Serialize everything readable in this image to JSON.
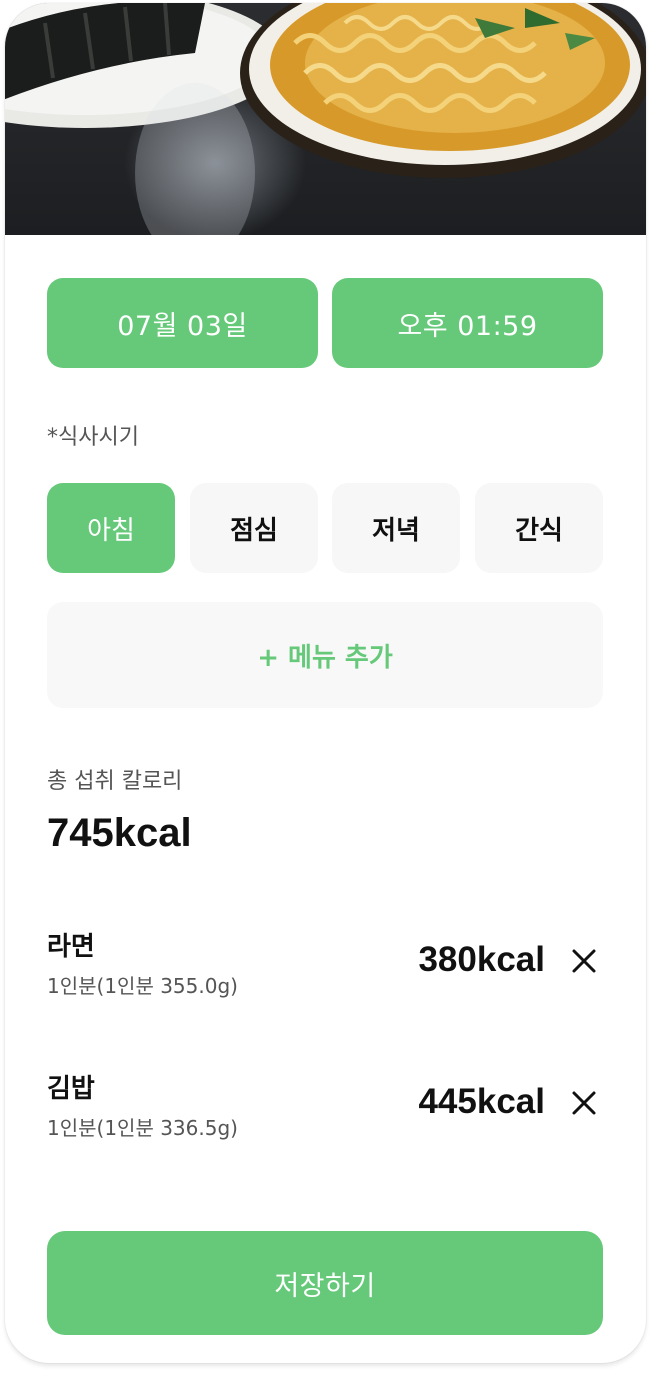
{
  "header": {
    "photo_icon": "food-photo"
  },
  "datetime": {
    "date": "07월 03일",
    "time": "오후 01:59"
  },
  "meal_time": {
    "label": "*식사시기",
    "options": [
      "아침",
      "점심",
      "저녁",
      "간식"
    ],
    "selected": "아침"
  },
  "add_menu": {
    "label": "+ 메뉴 추가"
  },
  "total": {
    "label": "총 섭취 칼로리",
    "value": "745kcal"
  },
  "foods": [
    {
      "name": "라면",
      "serving": "1인분(1인분 355.0g)",
      "kcal": "380kcal"
    },
    {
      "name": "김밥",
      "serving": "1인분(1인분 336.5g)",
      "kcal": "445kcal"
    }
  ],
  "save": {
    "label": "저장하기"
  },
  "colors": {
    "accent": "#66c97a",
    "surface": "#f7f7f7",
    "text": "#111111",
    "muted": "#555555"
  },
  "icons": {
    "remove": "close-icon",
    "photo": "food-photo"
  }
}
